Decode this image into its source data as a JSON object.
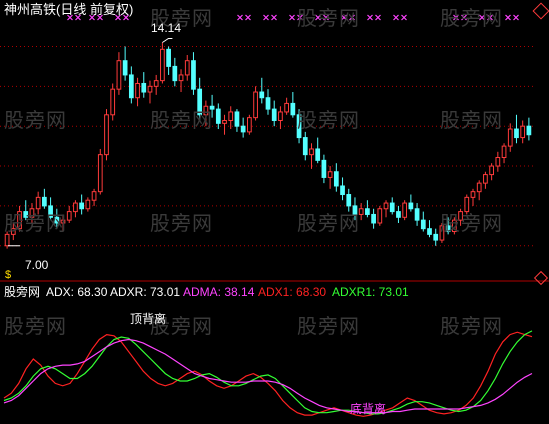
{
  "header": {
    "title": "神州高铁(日线 前复权)"
  },
  "price_panel": {
    "high_label": "14.14",
    "low_label": "7.00",
    "low_marker": "$",
    "ref_line_color": "#b00000",
    "up_color": "#ff3b3b",
    "down_color": "#54ffff"
  },
  "indicator_panel": {
    "name": "股旁网",
    "legend": [
      {
        "label": "ADX: 68.30",
        "color": "#ffffff"
      },
      {
        "label": "ADXR: 73.01",
        "color": "#ffffff"
      },
      {
        "label": "ADMA: 38.14",
        "color": "#ff44ff"
      },
      {
        "label": "ADX1: 68.30",
        "color": "#ff2222"
      },
      {
        "label": "ADXR1: 73.01",
        "color": "#33ff33"
      }
    ],
    "annotations": {
      "top_divergence": "顶背离",
      "bottom_divergence": "底背离"
    }
  },
  "watermark": "股旁网",
  "chart_data": {
    "type": "candlestick",
    "price_ylim": [
      6.5,
      15.0
    ],
    "candles": [
      [
        7.0,
        7.5,
        6.9,
        7.4
      ],
      [
        7.4,
        7.8,
        7.2,
        7.6
      ],
      [
        7.6,
        8.4,
        7.5,
        8.2
      ],
      [
        8.2,
        8.6,
        7.9,
        8.0
      ],
      [
        8.0,
        8.5,
        7.8,
        8.3
      ],
      [
        8.3,
        8.9,
        8.1,
        8.7
      ],
      [
        8.7,
        9.0,
        8.3,
        8.4
      ],
      [
        8.4,
        8.7,
        7.9,
        8.0
      ],
      [
        8.0,
        8.3,
        7.6,
        7.8
      ],
      [
        7.8,
        8.1,
        7.5,
        7.9
      ],
      [
        7.9,
        8.4,
        7.8,
        8.2
      ],
      [
        8.2,
        8.6,
        8.0,
        8.5
      ],
      [
        8.5,
        8.8,
        8.1,
        8.3
      ],
      [
        8.3,
        8.7,
        8.2,
        8.6
      ],
      [
        8.6,
        9.0,
        8.4,
        8.9
      ],
      [
        8.9,
        10.4,
        8.8,
        10.2
      ],
      [
        10.2,
        11.8,
        10.0,
        11.6
      ],
      [
        11.6,
        12.7,
        11.4,
        12.5
      ],
      [
        12.5,
        13.8,
        12.3,
        13.5
      ],
      [
        13.5,
        14.0,
        12.8,
        13.0
      ],
      [
        13.0,
        13.3,
        12.0,
        12.2
      ],
      [
        12.2,
        12.9,
        11.9,
        12.7
      ],
      [
        12.7,
        13.1,
        12.2,
        12.4
      ],
      [
        12.4,
        12.8,
        12.0,
        12.6
      ],
      [
        12.6,
        13.0,
        12.3,
        12.8
      ],
      [
        12.8,
        14.14,
        12.7,
        13.9
      ],
      [
        13.9,
        14.0,
        13.0,
        13.3
      ],
      [
        13.3,
        13.6,
        12.6,
        12.8
      ],
      [
        12.8,
        13.2,
        12.4,
        13.0
      ],
      [
        13.0,
        13.7,
        12.8,
        13.5
      ],
      [
        13.5,
        13.8,
        12.3,
        12.5
      ],
      [
        12.5,
        12.9,
        11.4,
        11.6
      ],
      [
        11.6,
        12.1,
        11.2,
        11.9
      ],
      [
        11.9,
        12.3,
        11.5,
        11.8
      ],
      [
        11.8,
        12.0,
        11.1,
        11.3
      ],
      [
        11.3,
        11.6,
        10.9,
        11.4
      ],
      [
        11.4,
        11.9,
        11.1,
        11.7
      ],
      [
        11.7,
        11.8,
        11.0,
        11.2
      ],
      [
        11.2,
        11.5,
        10.8,
        11.0
      ],
      [
        11.0,
        11.6,
        10.9,
        11.5
      ],
      [
        11.5,
        12.6,
        11.4,
        12.4
      ],
      [
        12.4,
        12.9,
        12.0,
        12.2
      ],
      [
        12.2,
        12.5,
        11.6,
        11.8
      ],
      [
        11.8,
        12.1,
        11.2,
        11.4
      ],
      [
        11.4,
        11.9,
        11.1,
        11.7
      ],
      [
        11.7,
        12.2,
        11.6,
        12.0
      ],
      [
        12.0,
        12.4,
        11.5,
        11.6
      ],
      [
        11.6,
        11.8,
        10.6,
        10.8
      ],
      [
        10.8,
        11.0,
        10.0,
        10.2
      ],
      [
        10.2,
        10.6,
        9.7,
        10.4
      ],
      [
        10.4,
        10.8,
        9.9,
        10.0
      ],
      [
        10.0,
        10.2,
        9.2,
        9.4
      ],
      [
        9.4,
        9.8,
        9.0,
        9.6
      ],
      [
        9.6,
        9.9,
        8.9,
        9.1
      ],
      [
        9.1,
        9.4,
        8.6,
        8.8
      ],
      [
        8.8,
        9.0,
        8.2,
        8.4
      ],
      [
        8.4,
        8.7,
        7.9,
        8.1
      ],
      [
        8.1,
        8.5,
        7.9,
        8.3
      ],
      [
        8.3,
        8.6,
        8.0,
        8.1
      ],
      [
        8.1,
        8.3,
        7.6,
        7.8
      ],
      [
        7.8,
        8.4,
        7.7,
        8.3
      ],
      [
        8.3,
        8.6,
        8.0,
        8.5
      ],
      [
        8.5,
        8.7,
        8.1,
        8.2
      ],
      [
        8.2,
        8.4,
        7.8,
        8.0
      ],
      [
        8.0,
        8.6,
        7.9,
        8.5
      ],
      [
        8.5,
        8.8,
        8.2,
        8.3
      ],
      [
        8.3,
        8.5,
        7.7,
        7.9
      ],
      [
        7.9,
        8.2,
        7.5,
        7.6
      ],
      [
        7.6,
        7.9,
        7.3,
        7.4
      ],
      [
        7.4,
        7.6,
        7.0,
        7.2
      ],
      [
        7.2,
        7.8,
        7.1,
        7.7
      ],
      [
        7.7,
        8.0,
        7.4,
        7.5
      ],
      [
        7.5,
        8.0,
        7.4,
        7.9
      ],
      [
        7.9,
        8.3,
        7.7,
        8.2
      ],
      [
        8.2,
        8.8,
        8.1,
        8.7
      ],
      [
        8.7,
        9.0,
        8.4,
        8.9
      ],
      [
        8.9,
        9.3,
        8.6,
        9.2
      ],
      [
        9.2,
        9.6,
        9.0,
        9.5
      ],
      [
        9.5,
        9.9,
        9.3,
        9.8
      ],
      [
        9.8,
        10.3,
        9.6,
        10.1
      ],
      [
        10.1,
        10.6,
        9.9,
        10.5
      ],
      [
        10.5,
        11.3,
        10.3,
        11.1
      ],
      [
        11.1,
        11.6,
        10.6,
        10.8
      ],
      [
        10.8,
        11.4,
        10.6,
        11.2
      ],
      [
        11.2,
        11.5,
        10.7,
        10.9
      ]
    ],
    "adx_ylim": [
      0,
      100
    ],
    "series": [
      {
        "name": "ADX",
        "color": "#ff2222",
        "values": [
          18,
          22,
          30,
          42,
          50,
          45,
          36,
          30,
          28,
          30,
          38,
          48,
          58,
          66,
          70,
          69,
          64,
          56,
          48,
          40,
          34,
          30,
          28,
          30,
          34,
          38,
          40,
          37,
          32,
          28,
          26,
          28,
          32,
          36,
          38,
          35,
          30,
          24,
          16,
          10,
          6,
          4,
          4,
          6,
          8,
          10,
          8,
          6,
          4,
          3,
          4,
          6,
          8,
          10,
          14,
          18,
          16,
          12,
          8,
          6,
          5,
          6,
          8,
          12,
          18,
          28,
          40,
          54,
          64,
          70,
          72,
          70,
          68.3
        ]
      },
      {
        "name": "ADXR",
        "color": "#33ff33",
        "values": [
          16,
          18,
          22,
          28,
          36,
          42,
          44,
          42,
          38,
          34,
          34,
          38,
          44,
          52,
          60,
          66,
          68,
          67,
          62,
          56,
          50,
          44,
          38,
          34,
          32,
          32,
          34,
          37,
          38,
          35,
          31,
          28,
          28,
          30,
          33,
          36,
          37,
          34,
          28,
          22,
          16,
          10,
          7,
          6,
          6,
          7,
          8,
          8,
          7,
          6,
          5,
          5,
          6,
          8,
          10,
          13,
          15,
          15,
          14,
          12,
          10,
          8,
          7,
          8,
          11,
          16,
          24,
          34,
          46,
          56,
          64,
          70,
          73.01
        ]
      },
      {
        "name": "ADMA",
        "color": "#ff44ff",
        "values": [
          14,
          16,
          20,
          26,
          32,
          38,
          42,
          44,
          45,
          45,
          46,
          48,
          52,
          56,
          60,
          63,
          65,
          66,
          65,
          63,
          60,
          57,
          54,
          50,
          46,
          42,
          38,
          36,
          34,
          33,
          32,
          31,
          31,
          31,
          32,
          32,
          32,
          31,
          29,
          26,
          22,
          18,
          15,
          12,
          10,
          9,
          8,
          7,
          7,
          6,
          6,
          6,
          6,
          7,
          7,
          8,
          9,
          9,
          9,
          9,
          9,
          9,
          9,
          10,
          11,
          12,
          14,
          17,
          21,
          26,
          31,
          35,
          38.14
        ]
      }
    ]
  }
}
